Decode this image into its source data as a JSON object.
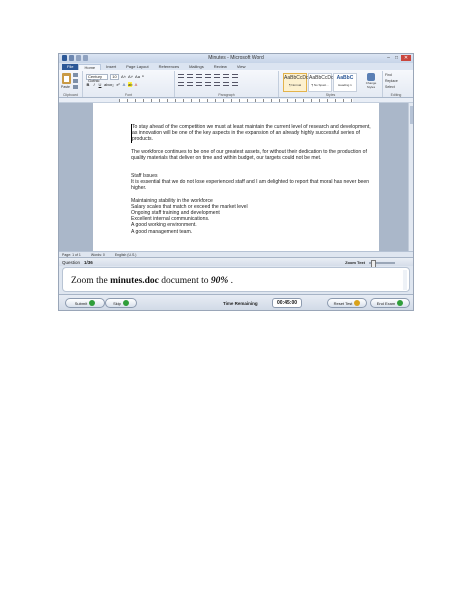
{
  "window": {
    "title": "Minutes - Microsoft Word",
    "controls": [
      "–",
      "□",
      "✕"
    ]
  },
  "ribbon": {
    "tabs": [
      "File",
      "Home",
      "Insert",
      "Page Layout",
      "References",
      "Mailings",
      "Review",
      "View"
    ],
    "font_name": "Century Gothic",
    "font_size": "10",
    "paste_label": "Paste",
    "groups": [
      "Clipboard",
      "Font",
      "Paragraph",
      "Styles",
      "Editing"
    ],
    "styles": [
      {
        "preview": "AaBbCcDc",
        "name": "¶ Normal"
      },
      {
        "preview": "AaBbCcDc",
        "name": "¶ No Spaci..."
      },
      {
        "preview": "AaBbC",
        "name": "Heading 1"
      }
    ],
    "change_styles": "Change Styles",
    "editing": [
      "Find",
      "Replace",
      "Select"
    ]
  },
  "document": {
    "paragraphs": [
      "To stay ahead of the competition we must at least maintain the current level of research and development, as innovation will be one of the key aspects in the expansion of an already highly successful series of products.",
      "The workforce continues to be one of our greatest assets, for without their dedication to the production of quality materials that deliver on time and within budget, our targets could not be met."
    ],
    "heading": "Staff Issues",
    "issues_text": "It is essential that we do not lose experienced staff and I am delighted to report that moral has never been higher.",
    "list": [
      "Maintaining stability in the workforce",
      "Salary scales that match or exceed the market level",
      "Ongoing staff training and development",
      "Excellent internal communications.",
      "A good working environment.",
      "A good management team."
    ]
  },
  "statusbar": {
    "page": "Page: 1 of 1",
    "words": "Words: 0",
    "language": "English (U.S.)"
  },
  "exam": {
    "question_label": "Question",
    "question_number": "1/36",
    "zoom_text_label": "Zoom Text",
    "question": {
      "prefix": "Zoom the ",
      "file": "minutes.doc",
      "middle": " document to ",
      "value": "90%",
      "suffix": " ."
    },
    "buttons": {
      "submit": "Submit",
      "skip": "Skip",
      "reset": "Reset Test",
      "end": "End Exam"
    },
    "time_label": "Time Remaining",
    "time_value": "00:45:00",
    "colors": {
      "submit": "#2f9e3a",
      "skip": "#2f9e3a",
      "reset": "#d9a21b",
      "end": "#2f9e3a"
    }
  }
}
